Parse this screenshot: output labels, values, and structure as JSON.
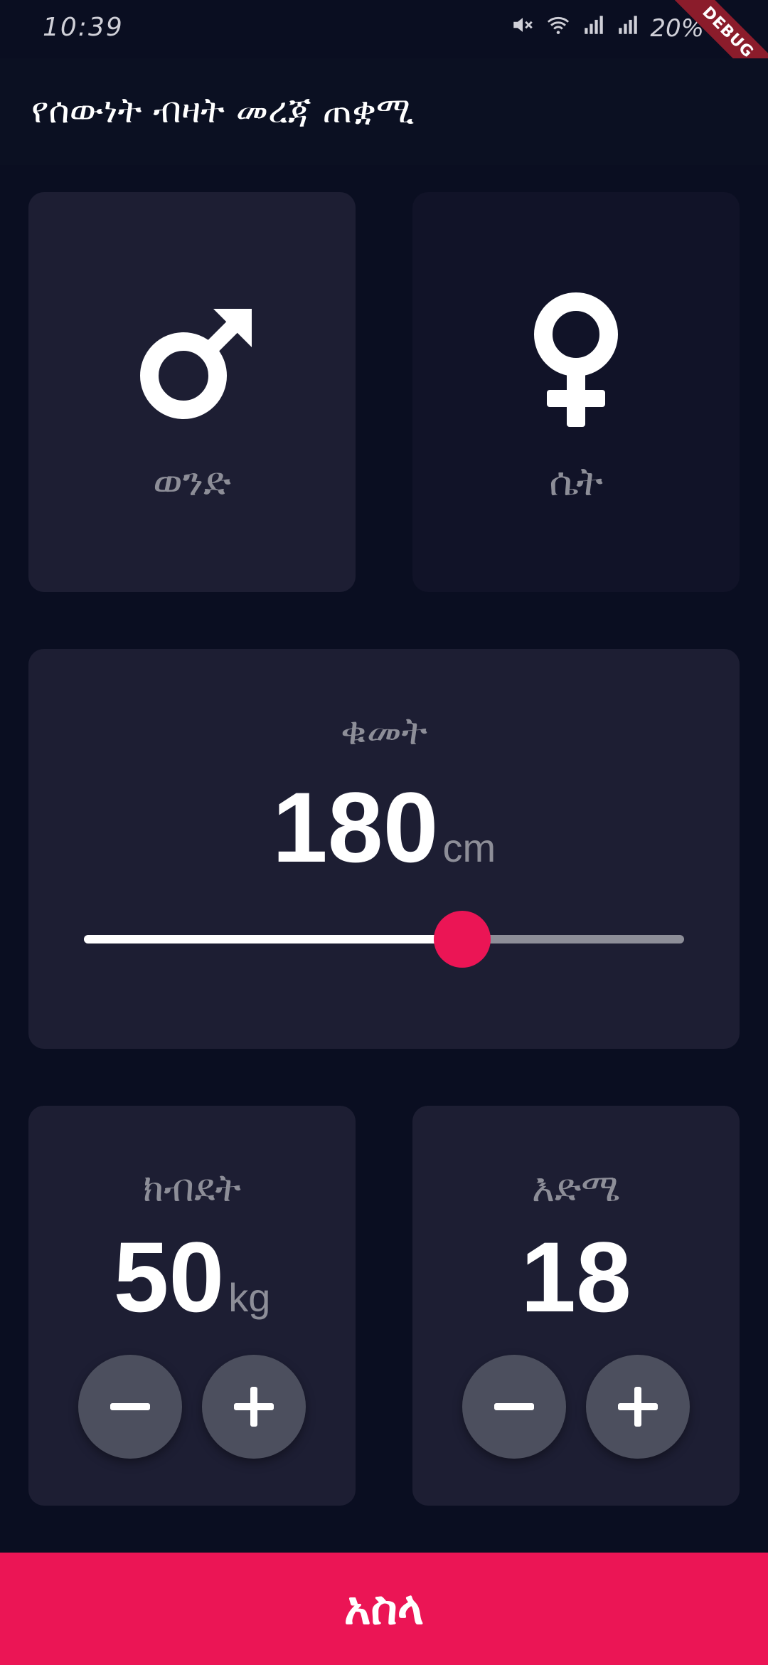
{
  "status_bar": {
    "time": "10:39",
    "battery": "20%",
    "debug_banner": "DEBUG"
  },
  "app_bar": {
    "title": "የሰውነት ብዛት መረጃ ጠቋሚ"
  },
  "gender": {
    "male": {
      "label": "ወንድ",
      "icon": "male-icon",
      "selected": true
    },
    "female": {
      "label": "ሴት",
      "icon": "female-icon",
      "selected": false
    }
  },
  "height": {
    "label": "ቁመት",
    "value": "180",
    "unit": "cm",
    "slider_fraction": 0.63
  },
  "weight": {
    "label": "ክብደት",
    "value": "50",
    "unit": "kg"
  },
  "age": {
    "label": "እድሜ",
    "value": "18"
  },
  "calculate": {
    "label": "አስላ"
  },
  "colors": {
    "background": "#0a0e21",
    "active_card": "#1d1e33",
    "inactive_card": "#111328",
    "accent": "#eb1555",
    "muted_text": "#8d8e98",
    "round_button": "#4c4f5e"
  }
}
